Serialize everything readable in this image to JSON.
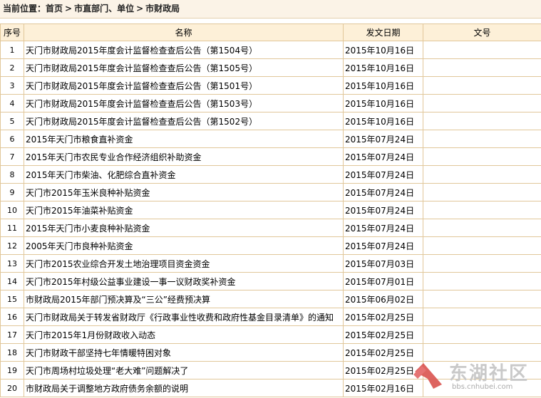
{
  "breadcrumb": {
    "prefix": "当前位置：",
    "items": [
      "首页",
      "市直部门、单位",
      "市财政局"
    ],
    "separator": ">"
  },
  "table": {
    "headers": [
      "序号",
      "名称",
      "发文日期",
      "文号"
    ],
    "rows": [
      {
        "no": "1",
        "title": "天门市财政局2015年度会计监督检查查后公告（第1504号）",
        "date": "2015年10月16日",
        "doc_no": ""
      },
      {
        "no": "2",
        "title": "天门市财政局2015年度会计监督检查查后公告（第1505号）",
        "date": "2015年10月16日",
        "doc_no": ""
      },
      {
        "no": "3",
        "title": "天门市财政局2015年度会计监督检查查后公告（第1501号）",
        "date": "2015年10月16日",
        "doc_no": ""
      },
      {
        "no": "4",
        "title": "天门市财政局2015年度会计监督检查查后公告（第1503号）",
        "date": "2015年10月16日",
        "doc_no": ""
      },
      {
        "no": "5",
        "title": "天门市财政局2015年度会计监督检查查后公告（第1502号）",
        "date": "2015年10月16日",
        "doc_no": ""
      },
      {
        "no": "6",
        "title": "2015年天门市粮食直补资金",
        "date": "2015年07月24日",
        "doc_no": ""
      },
      {
        "no": "7",
        "title": "2015年天门市农民专业合作经济组织补助资金",
        "date": "2015年07月24日",
        "doc_no": ""
      },
      {
        "no": "8",
        "title": "2015年天门市柴油、化肥综合直补资金",
        "date": "2015年07月24日",
        "doc_no": ""
      },
      {
        "no": "9",
        "title": "天门市2015年玉米良种补贴资金",
        "date": "2015年07月24日",
        "doc_no": ""
      },
      {
        "no": "10",
        "title": "天门市2015年油菜补贴资金",
        "date": "2015年07月24日",
        "doc_no": ""
      },
      {
        "no": "11",
        "title": "2015年天门市小麦良种补贴资金",
        "date": "2015年07月24日",
        "doc_no": ""
      },
      {
        "no": "12",
        "title": "2005年天门市良种补贴资金",
        "date": "2015年07月24日",
        "doc_no": ""
      },
      {
        "no": "13",
        "title": "天门市2015农业综合开发土地治理项目资金资金",
        "date": "2015年07月03日",
        "doc_no": ""
      },
      {
        "no": "14",
        "title": "天门市2015年村级公益事业建设一事一议财政奖补资金",
        "date": "2015年07月01日",
        "doc_no": ""
      },
      {
        "no": "15",
        "title": "市财政局2015年部门预决算及“三公”经费预决算",
        "date": "2015年06月02日",
        "doc_no": ""
      },
      {
        "no": "16",
        "title": "天门市财政局关于转发省财政厅《行政事业性收费和政府性基金目录清单》的通知",
        "date": "2015年02月25日",
        "doc_no": ""
      },
      {
        "no": "17",
        "title": "天门市2015年1月份财政收入动态",
        "date": "2015年02月25日",
        "doc_no": ""
      },
      {
        "no": "18",
        "title": "天门市财政干部坚持七年情暖特困对象",
        "date": "2015年02月25日",
        "doc_no": ""
      },
      {
        "no": "19",
        "title": "天门市周场村垃圾处理“老大难”问题解决了",
        "date": "2015年02月25日",
        "doc_no": ""
      },
      {
        "no": "20",
        "title": "市财政局关于调整地方政府债务余额的说明",
        "date": "2015年02月16日",
        "doc_no": ""
      }
    ]
  },
  "watermark": {
    "text": "东湖社区",
    "url": "bbs.cnhubei.com",
    "icon": "donghu-logo-icon",
    "colors": {
      "logo": "#d9534f",
      "text": "#c9c9c9"
    }
  },
  "colors": {
    "header_bg": "#fdf0d8",
    "border": "#e1c79a",
    "breadcrumb_bg": "#fbf3e7"
  }
}
